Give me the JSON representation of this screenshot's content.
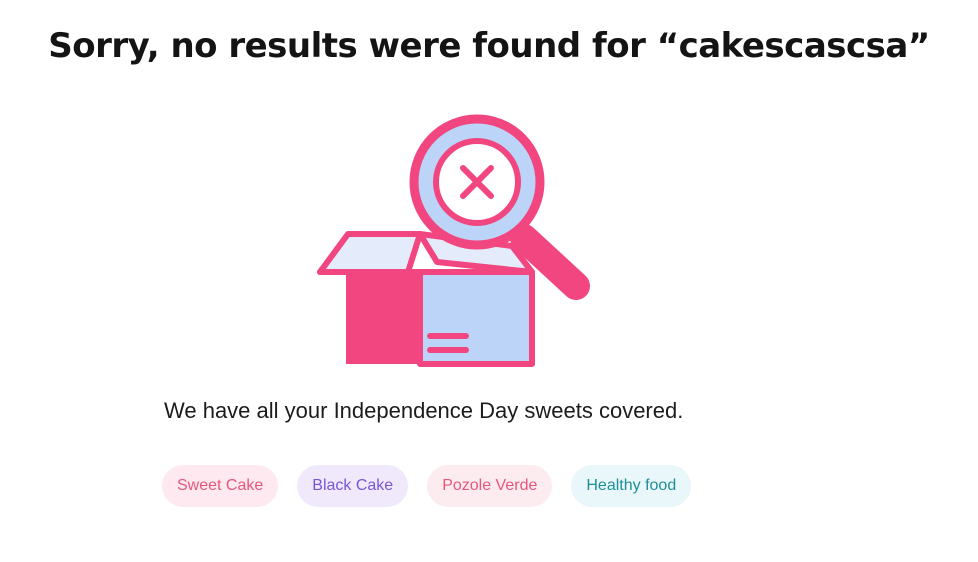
{
  "header": {
    "title": "Sorry, no results were found for “cakescascsa”"
  },
  "illustration": {
    "icon": "empty-box-magnifier-icon",
    "colors": {
      "pink": "#f1467f",
      "light_blue": "#bcd4f7",
      "pale_blue": "#e4ecfc"
    }
  },
  "message": "We have all your Independence Day sweets covered.",
  "suggestions": [
    {
      "label": "Sweet Cake",
      "bg": "#fde9ef",
      "color": "#e8567d"
    },
    {
      "label": "Black Cake",
      "bg": "#efe9fb",
      "color": "#7a55d6"
    },
    {
      "label": "Pozole Verde",
      "bg": "#fdecef",
      "color": "#e8567d"
    },
    {
      "label": "Healthy food",
      "bg": "#e9f7fa",
      "color": "#1d8f97"
    }
  ]
}
